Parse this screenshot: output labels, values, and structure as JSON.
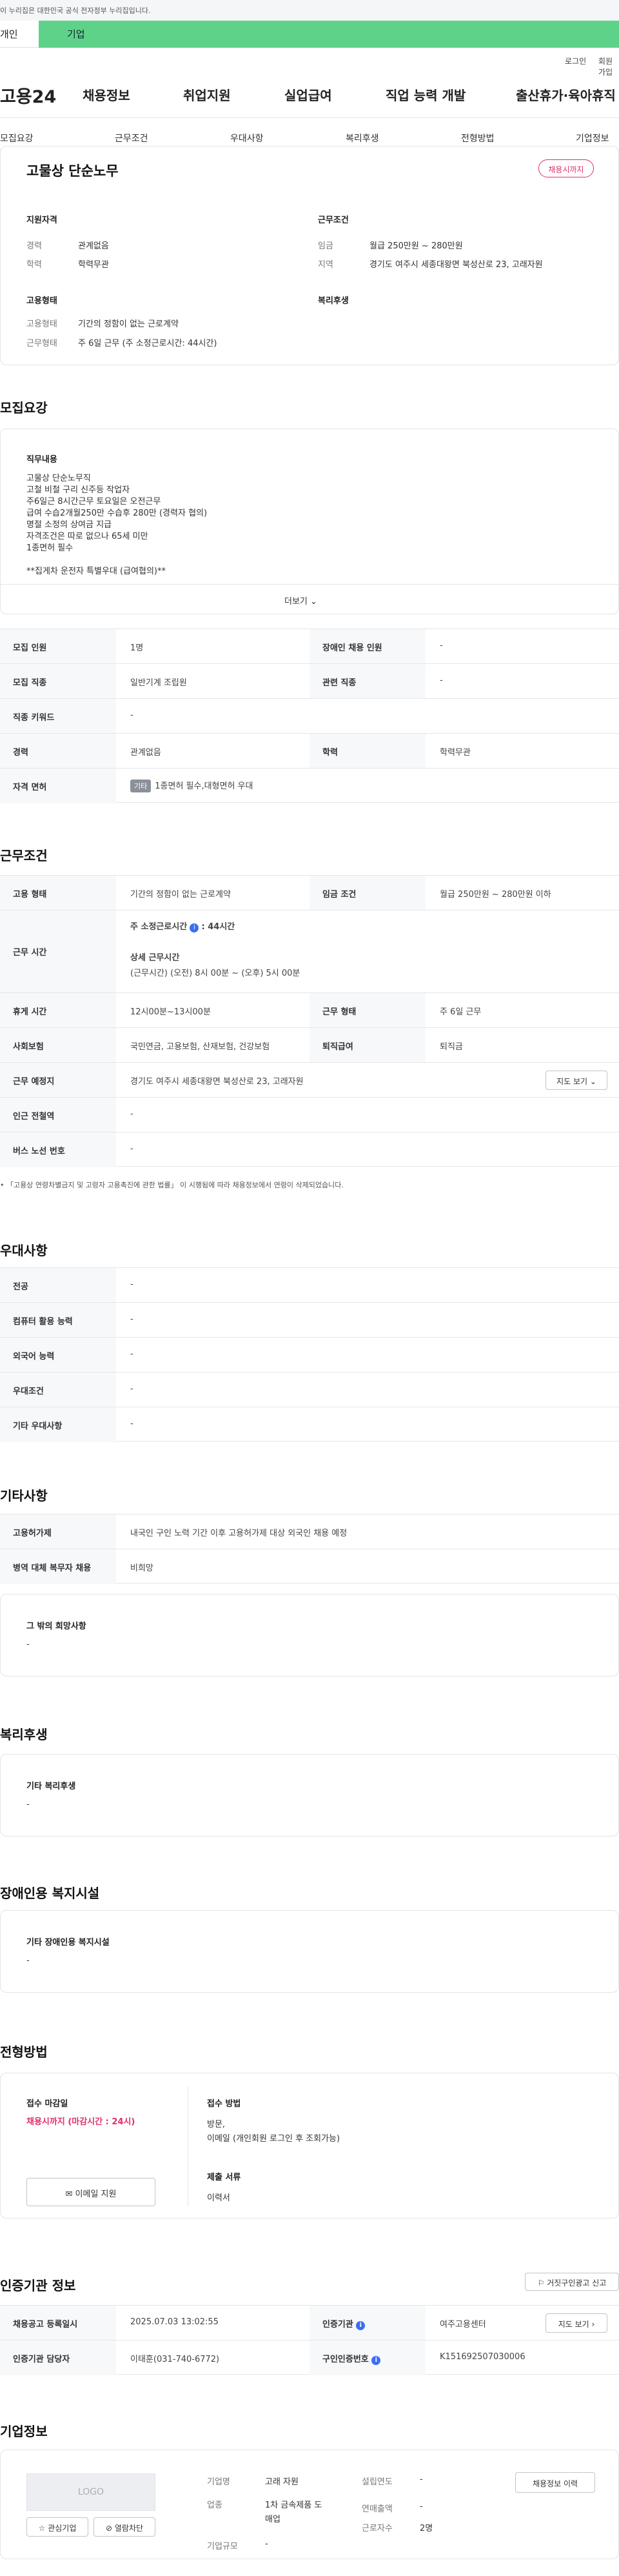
{
  "gov_banner": "이 누리집은 대한민국 공식 전자정부 누리집입니다.",
  "top_tabs": [
    "개인",
    "기업"
  ],
  "util": {
    "login": "로그인",
    "join": "회원가입"
  },
  "logo": "고용24",
  "gnb": [
    "채용정보",
    "취업지원",
    "실업급여",
    "직업 능력 개발",
    "출산휴가·육아휴직"
  ],
  "anchors": [
    "모집요강",
    "근무조건",
    "우대사항",
    "복리후생",
    "전형방법",
    "기업정보"
  ],
  "summary": {
    "title": "고물상 단순노무",
    "badge": "채용시까지",
    "qual_head": "지원자격",
    "cond_head": "근무조건",
    "form_head": "고용형태",
    "welfare_head": "복리후생",
    "career_lbl": "경력",
    "career": "관계없음",
    "edu_lbl": "학력",
    "edu": "학력무관",
    "wage_lbl": "임금",
    "wage": "월급 250만원 ~ 280만원",
    "region_lbl": "지역",
    "region": "경기도 여주시 세종대왕면 북성산로 23, 고래자원",
    "emp_lbl": "고용형태",
    "emp": "기간의 정함이 없는 근로계약",
    "work_lbl": "근무형태",
    "work": "주 6일 근무 (주 소정근로시간: 44시간)"
  },
  "recruit": {
    "heading": "모집요강",
    "job_head": "직무내용",
    "job_lines": [
      "고물상 단순노무직",
      "고철 비철 구리 신주등 작업자",
      "주6일근 8시간근무 토요일은 오전근무",
      "급여 수습2개월250만 수습후 280만 (경력자 협의)",
      "명절 소정의 상여금 지급",
      "자격조건은 따로 없으나 65세 미만",
      "1종면허 필수",
      "",
      "**집게차 운전자 특별우대 (급여협의)**"
    ],
    "more": "더보기",
    "rows": [
      {
        "k1": "모집 인원",
        "v1": "1명",
        "k2": "장애인 채용 인원",
        "v2": "-"
      },
      {
        "k1": "모집 직종",
        "v1": "일반기계 조립원",
        "k2": "관련 직종",
        "v2": "-"
      },
      {
        "k1": "직종 키워드",
        "v1": "-",
        "k2": "",
        "v2": ""
      },
      {
        "k1": "경력",
        "v1": "관계없음",
        "k2": "학력",
        "v2": "학력무관"
      }
    ],
    "license_lbl": "자격 면허",
    "license_tag": "기타",
    "license": "1종면허 필수,대형면허 우대"
  },
  "conditions": {
    "heading": "근무조건",
    "emp_lbl": "고용 형태",
    "emp": "기간의 정함이 없는 근로계약",
    "wage_lbl": "임금 조건",
    "wage": "월급 250만원 ~ 280만원 이하",
    "hours_lbl": "근무 시간",
    "weekly": "주 소정근로시간",
    "weekly_val": ": 44시간",
    "detail_head": "상세 근무시간",
    "detail": "(근무시간) (오전) 8시 00분 ~ (오후) 5시 00분",
    "break_lbl": "휴게 시간",
    "break": "12시00분~13시00분",
    "form_lbl": "근무 형태",
    "form": "주 6일 근무",
    "ins_lbl": "사회보험",
    "ins": "국민연금, 고용보험, 산재보험, 건강보험",
    "sev_lbl": "퇴직급여",
    "sev": "퇴직금",
    "place_lbl": "근무 예정지",
    "place": "경기도 여주시 세종대왕면 북성산로 23, 고래자원",
    "map": "지도 보기",
    "sub_lbl": "인근 전철역",
    "sub": "-",
    "bus_lbl": "버스 노선 번호",
    "bus": "-",
    "note": "「고용상 연령차별금지 및 고령자 고용촉진에 관한 법률」 이 시행됨에 따라 채용정보에서 연령이 삭제되었습니다."
  },
  "pref": {
    "heading": "우대사항",
    "rows": [
      [
        "전공",
        "-"
      ],
      [
        "컴퓨터 활용 능력",
        "-"
      ],
      [
        "외국어 능력",
        "-"
      ],
      [
        "우대조건",
        "-"
      ],
      [
        "기타 우대사항",
        "-"
      ]
    ]
  },
  "etc": {
    "heading": "기타사항",
    "rows": [
      [
        "고용허가제",
        "내국인 구인 노력 기간 이후 고용허가제 대상 외국인 채용 예정"
      ],
      [
        "병역 대체 복무자 채용",
        "비희망"
      ]
    ],
    "other_head": "그 밖의 희망사항",
    "other": "-"
  },
  "welfare": {
    "heading": "복리후생",
    "head": "기타 복리후생",
    "val": "-"
  },
  "disabled": {
    "heading": "장애인용 복지시설",
    "head": "기타 장애인용 복지시설",
    "val": "-"
  },
  "screening": {
    "heading": "전형방법",
    "deadline_head": "접수 마감일",
    "deadline": "채용시까지 (마감시간 : 24시)",
    "email_btn": "이메일 지원",
    "method_head": "접수 방법",
    "method1": "방문,",
    "method2": "이메일 (개인회원 로그인 후 조회가능)",
    "docs_head": "제출 서류",
    "docs": "이력서"
  },
  "agency": {
    "heading": "인증기관 정보",
    "report": "거짓구인광고 신고",
    "reg_lbl": "채용공고 등록일시",
    "reg": "2025.07.03 13:02:55",
    "org_lbl": "인증기관",
    "org": "여주고용센터",
    "map": "지도 보기",
    "mgr_lbl": "인증기관 담당자",
    "mgr": "이태훈(031-740-6772)",
    "no_lbl": "구인인증번호",
    "no": "K151692507030006"
  },
  "company": {
    "heading": "기업정보",
    "logo": "LOGO",
    "fav": "관심기업",
    "block": "열람차단",
    "name_lbl": "기업명",
    "name": "고래 자원",
    "year_lbl": "설립연도",
    "year": "-",
    "ind_lbl": "업종",
    "ind1": "1차 금속제품 도",
    "ind2": "매업",
    "sales_lbl": "연매출액",
    "sales": "-",
    "emp_lbl": "근로자수",
    "emp": "2명",
    "size_lbl": "기업규모",
    "size": "-",
    "history": "채용정보 이력"
  }
}
